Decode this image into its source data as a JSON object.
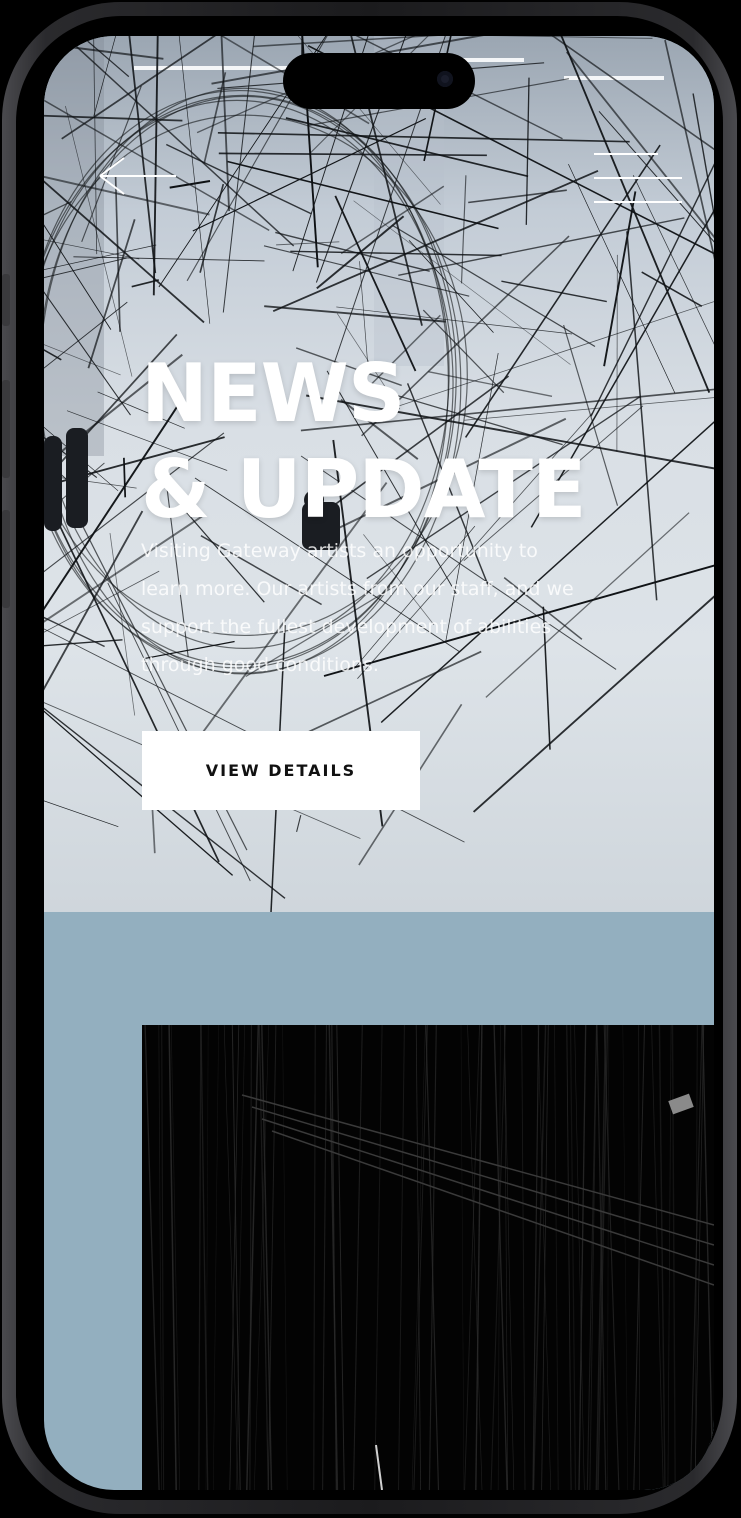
{
  "hero": {
    "title_line1": "NEWS",
    "title_line2": "& UPDATE",
    "description": "Visiting Gateway artists an opportunity to learn more. Our artists from our staff, and we support the fullest development of abilities through good conditions.",
    "cta_label": "VIEW DETAILS"
  },
  "icons": {
    "back": "arrow-left-icon",
    "menu": "hamburger-menu-icon"
  },
  "colors": {
    "accent_panel": "#93afbf",
    "button_bg": "#ffffff",
    "button_text": "#111111"
  }
}
